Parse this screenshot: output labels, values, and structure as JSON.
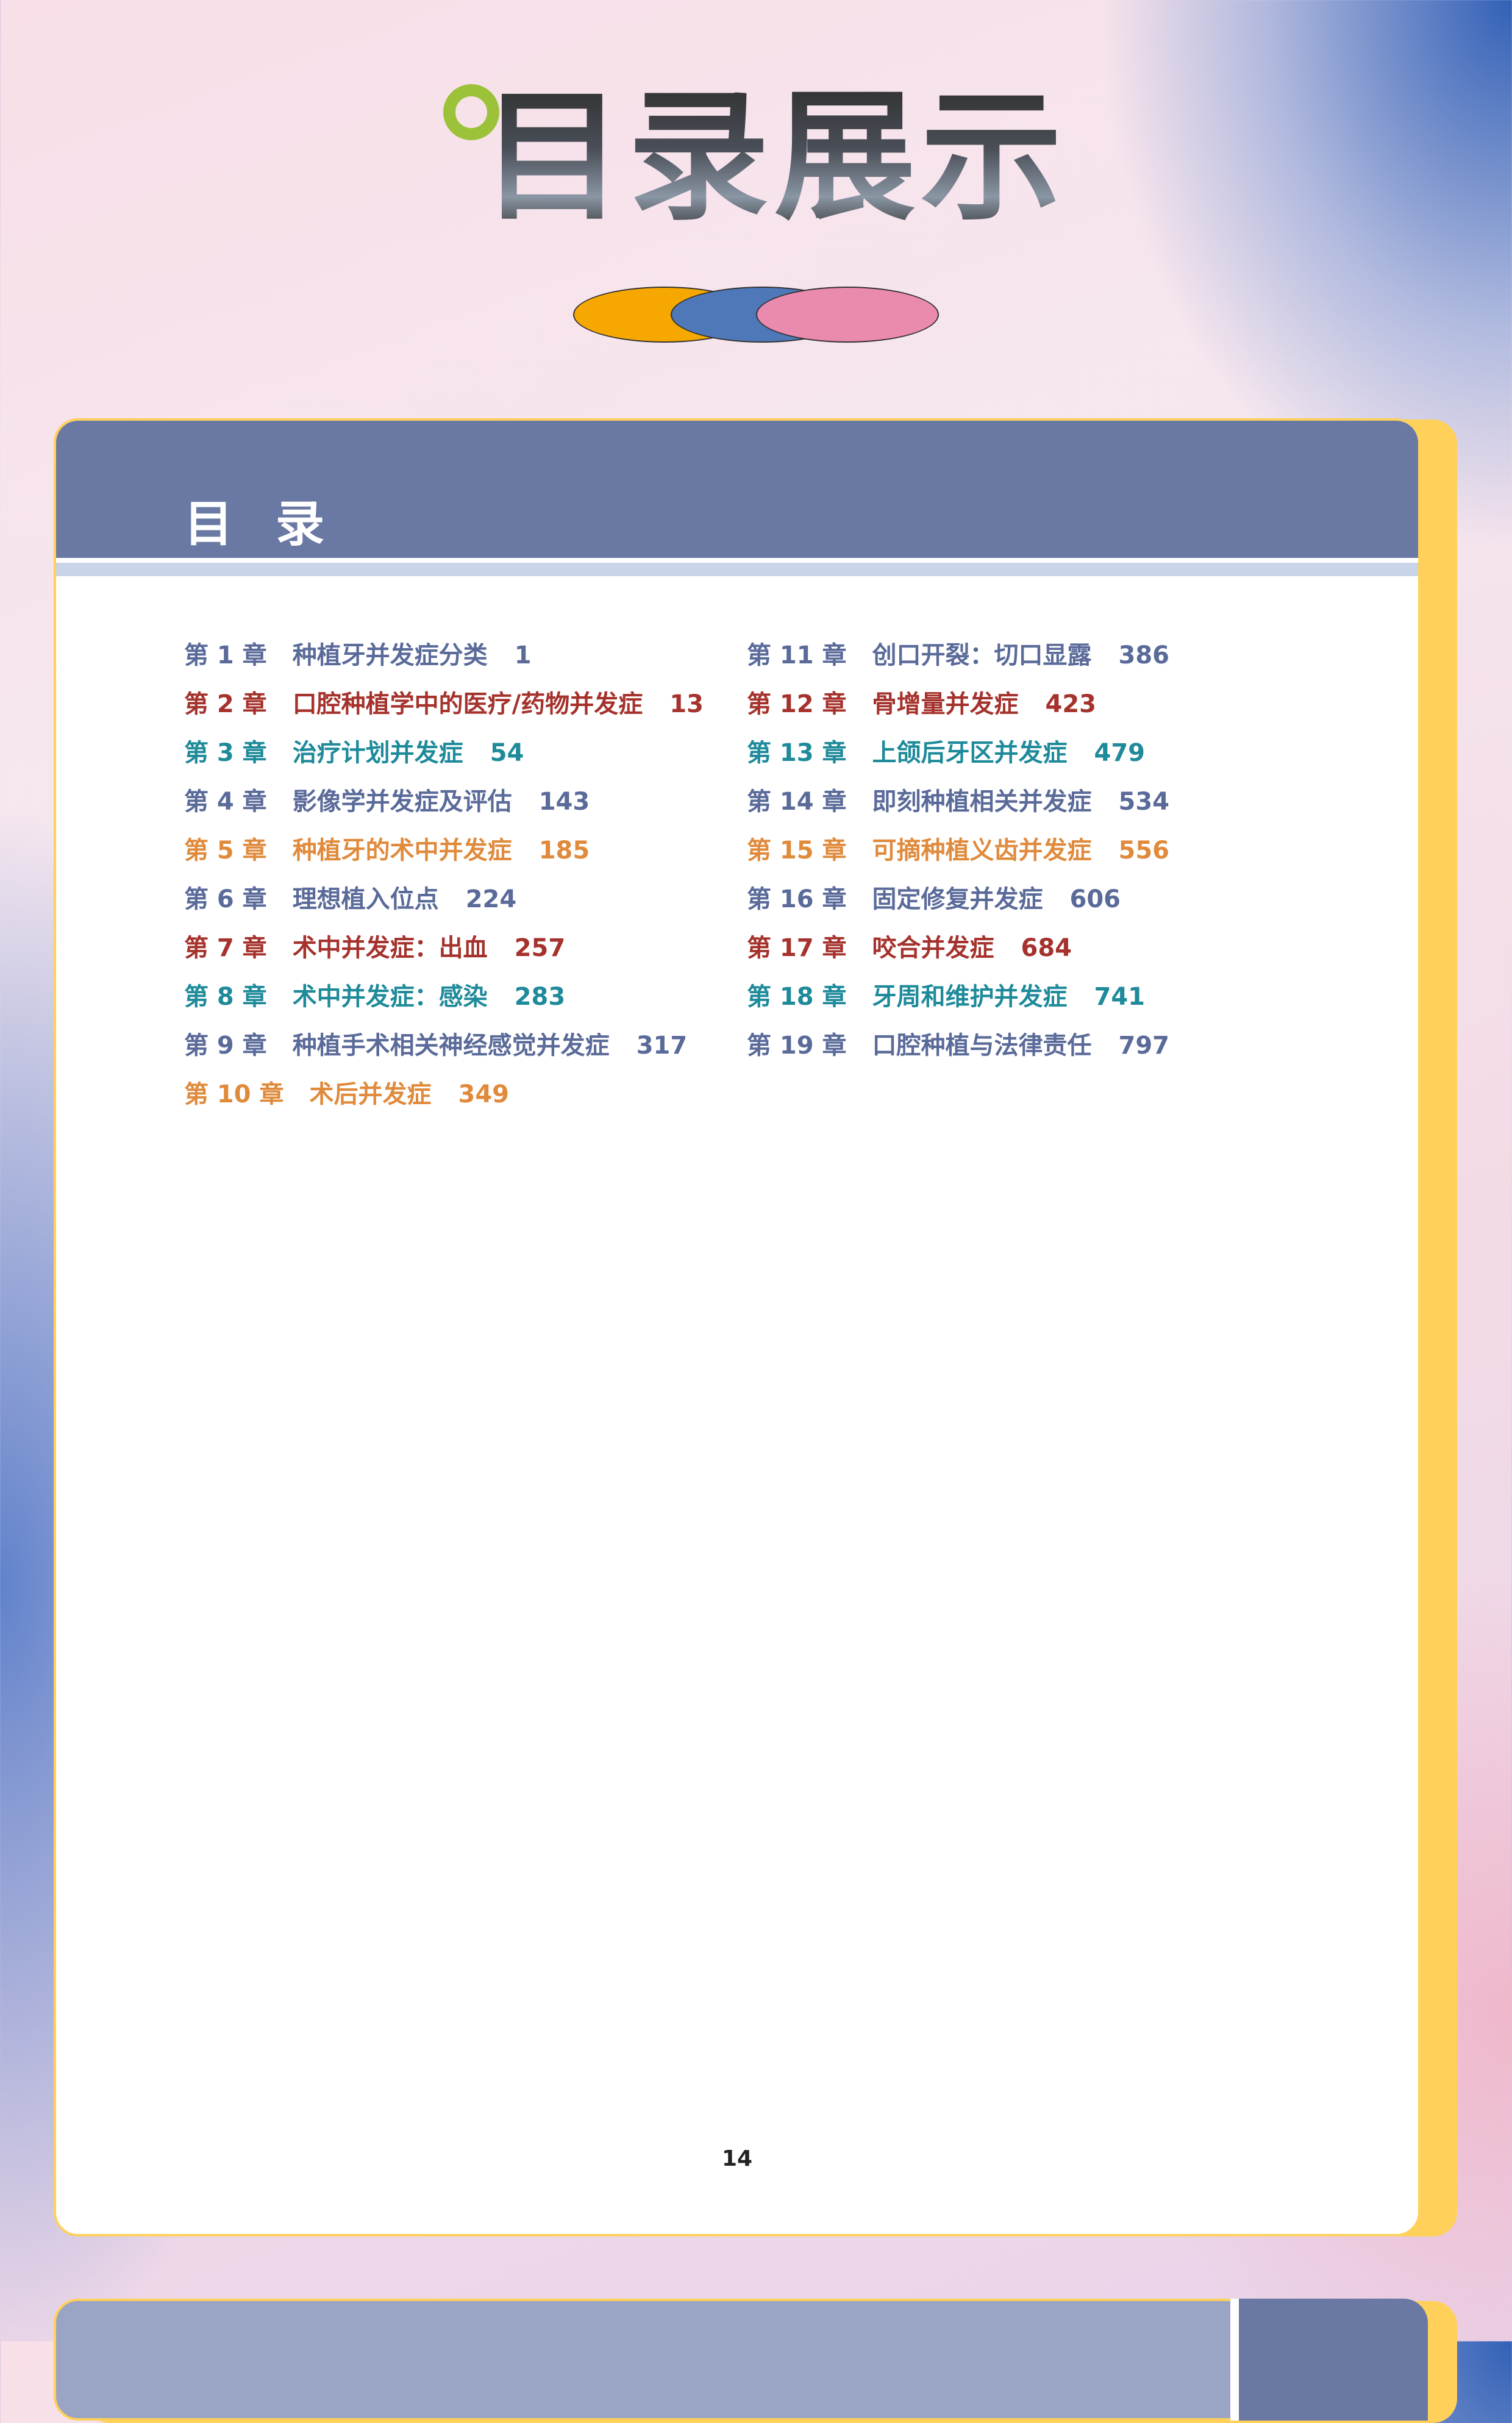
{
  "page_title": "目录展示",
  "decor_colors": {
    "orange": "#f7a800",
    "blue": "#4f78b8",
    "pink": "#e98aae",
    "ring": "#9cc23a"
  },
  "toc": {
    "header": "目录",
    "left": [
      {
        "chapter": "第 1 章",
        "title": "种植牙并发症分类",
        "page": "1",
        "color": "#5a6a99"
      },
      {
        "chapter": "第 2 章",
        "title": "口腔种植学中的医疗/药物并发症",
        "page": "13",
        "color": "#a5322c"
      },
      {
        "chapter": "第 3 章",
        "title": "治疗计划并发症",
        "page": "54",
        "color": "#1e8a9a"
      },
      {
        "chapter": "第 4 章",
        "title": "影像学并发症及评估",
        "page": "143",
        "color": "#5a6a99"
      },
      {
        "chapter": "第 5 章",
        "title": "种植牙的术中并发症",
        "page": "185",
        "color": "#e08a3c"
      },
      {
        "chapter": "第 6 章",
        "title": "理想植入位点",
        "page": "224",
        "color": "#5a6a99"
      },
      {
        "chapter": "第 7 章",
        "title": "术中并发症：出血",
        "page": "257",
        "color": "#a5322c"
      },
      {
        "chapter": "第 8 章",
        "title": "术中并发症：感染",
        "page": "283",
        "color": "#1e8a9a"
      },
      {
        "chapter": "第 9 章",
        "title": "种植手术相关神经感觉并发症",
        "page": "317",
        "color": "#5a6a99"
      },
      {
        "chapter": "第 10 章",
        "title": "术后并发症",
        "page": "349",
        "color": "#e08a3c"
      }
    ],
    "right": [
      {
        "chapter": "第 11 章",
        "title": "创口开裂：切口显露",
        "page": "386",
        "color": "#5a6a99"
      },
      {
        "chapter": "第 12 章",
        "title": "骨增量并发症",
        "page": "423",
        "color": "#a5322c"
      },
      {
        "chapter": "第 13 章",
        "title": "上颌后牙区并发症",
        "page": "479",
        "color": "#1e8a9a"
      },
      {
        "chapter": "第 14 章",
        "title": "即刻种植相关并发症",
        "page": "534",
        "color": "#5a6a99"
      },
      {
        "chapter": "第 15 章",
        "title": "可摘种植义齿并发症",
        "page": "556",
        "color": "#e08a3c"
      },
      {
        "chapter": "第 16 章",
        "title": "固定修复并发症",
        "page": "606",
        "color": "#5a6a99"
      },
      {
        "chapter": "第 17 章",
        "title": "咬合并发症",
        "page": "684",
        "color": "#a5322c"
      },
      {
        "chapter": "第 18 章",
        "title": "牙周和维护并发症",
        "page": "741",
        "color": "#1e8a9a"
      },
      {
        "chapter": "第 19 章",
        "title": "口腔种植与法律责任",
        "page": "797",
        "color": "#5a6a99"
      }
    ],
    "page_number": "14"
  }
}
